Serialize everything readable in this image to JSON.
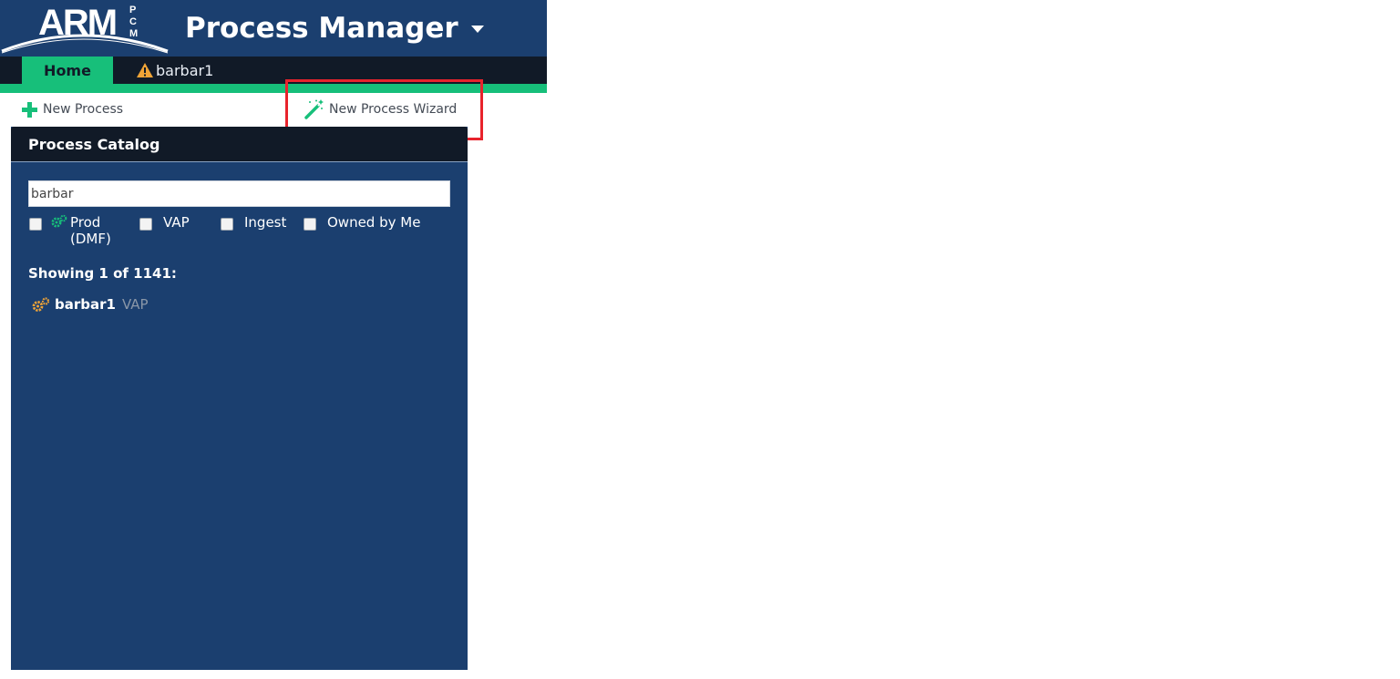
{
  "header": {
    "logo_text": "ARM",
    "logo_sub": "PCM",
    "app_title": "Process Manager"
  },
  "tabs": [
    {
      "label": "Home",
      "active": true
    },
    {
      "label": "barbar1",
      "warning": true
    }
  ],
  "toolbar": {
    "new_process_label": "New Process",
    "wizard_label": "New Process Wizard"
  },
  "catalog": {
    "title": "Process Catalog",
    "search_value": "barbar",
    "filters": [
      {
        "label": "Prod (DMF)",
        "checked": false,
        "icon": "gears-icon"
      },
      {
        "label": "VAP",
        "checked": false
      },
      {
        "label": "Ingest",
        "checked": false
      },
      {
        "label": "Owned by Me",
        "checked": false
      }
    ],
    "showing_text": "Showing 1 of 1141:",
    "results": [
      {
        "name": "barbar1",
        "type": "VAP",
        "icon": "gears-icon"
      }
    ]
  },
  "colors": {
    "header_bg": "#1b3f6f",
    "tabbar_bg": "#111a27",
    "accent_green": "#17bf7a",
    "warning_orange": "#f0a437",
    "highlight_red": "#e8232c"
  }
}
